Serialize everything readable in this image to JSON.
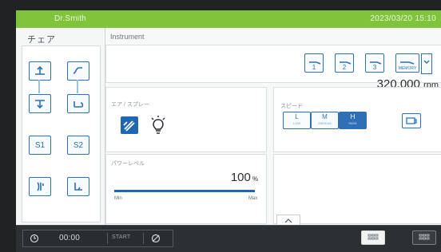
{
  "topbar": {
    "title": "Dr.Smith",
    "info": "2023/03/20 15:10"
  },
  "sidebar": {
    "title": "チェア",
    "items": [
      {
        "label": "up-icon"
      },
      {
        "label": "curve-icon"
      },
      {
        "label": "down-icon"
      },
      {
        "label": "return-icon"
      },
      {
        "label": "S1"
      },
      {
        "label": "S2"
      },
      {
        "label": "chair-up-icon"
      },
      {
        "label": "chair-bottom-icon"
      }
    ]
  },
  "main": {
    "title": "Instrument",
    "programs": [
      "1",
      "2",
      "3",
      "MEMORY"
    ],
    "rpm_value": "320,000",
    "rpm_unit": "rpm",
    "section_spray": "エア / スプレー",
    "section_light": "ライト",
    "section_speed": "スピード",
    "speeds": [
      {
        "label": "L",
        "sub": "LOW"
      },
      {
        "label": "M",
        "sub": "MEDIUM"
      },
      {
        "label": "H",
        "sub": "HIGH"
      }
    ],
    "power_label": "パワーレベル",
    "power_value": "100",
    "power_unit": "%",
    "power_fraction": 1.0,
    "scale_min": "Min",
    "scale_max": "Max"
  },
  "bottom": {
    "timer": "00:00",
    "start": "START"
  }
}
